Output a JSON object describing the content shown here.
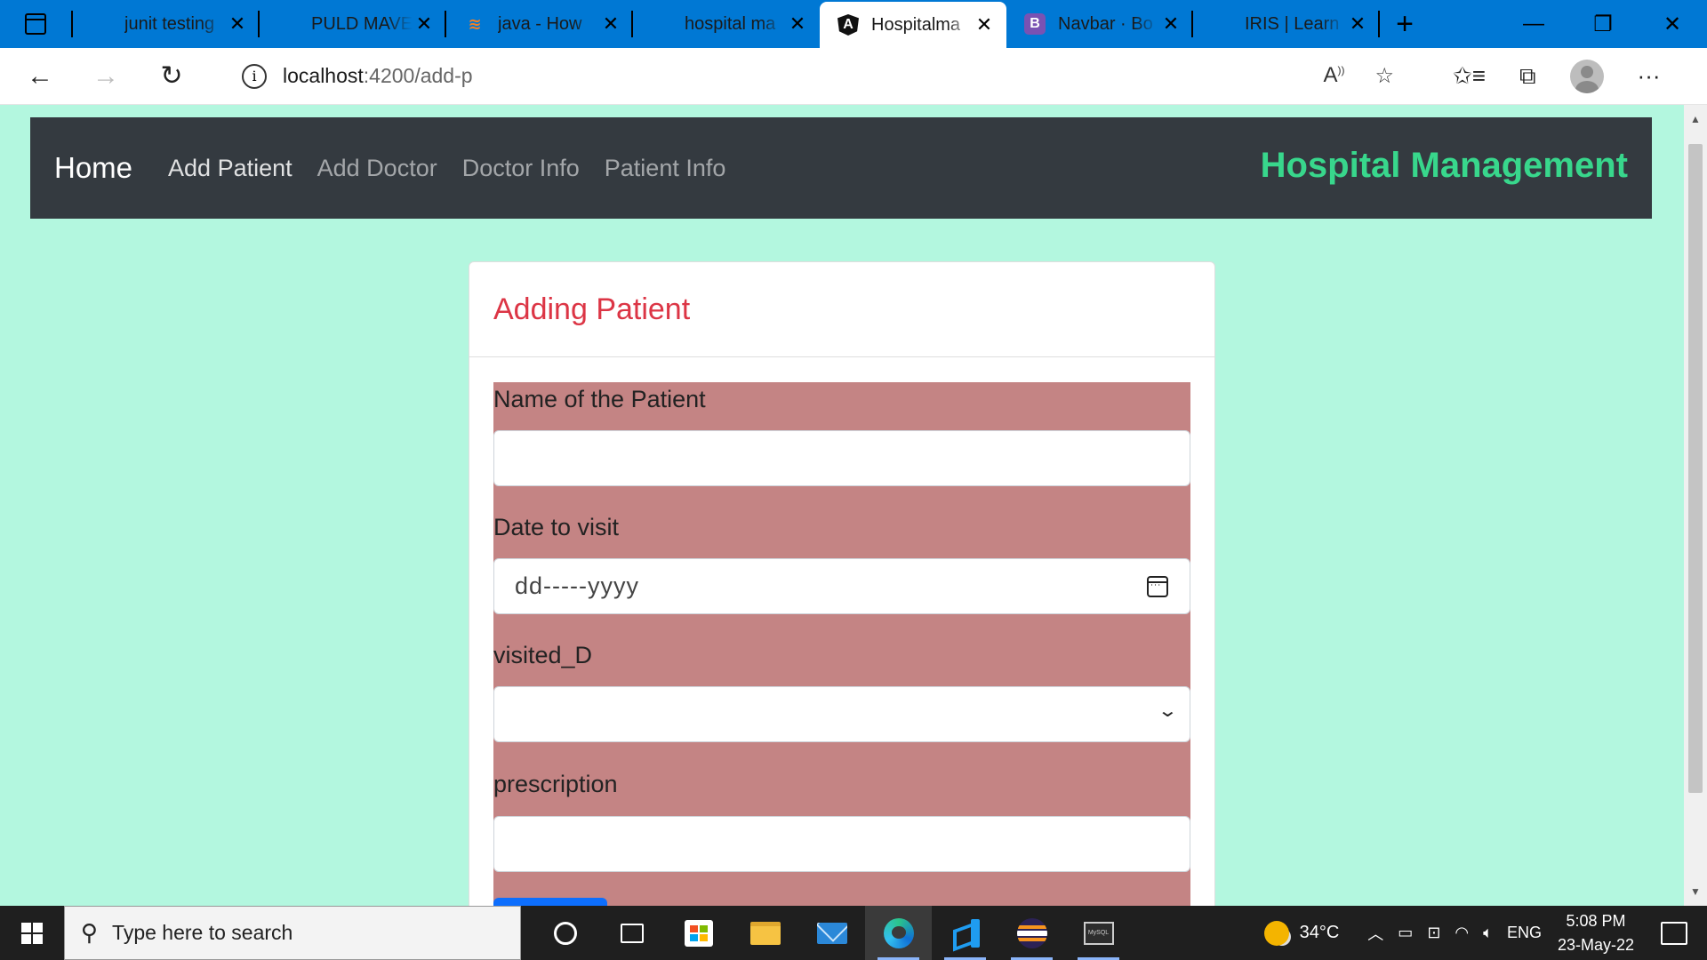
{
  "browser": {
    "tabs": [
      {
        "title": "junit testing",
        "favicon": "",
        "active": false
      },
      {
        "title": "PULD MAVEN",
        "favicon": "",
        "active": false
      },
      {
        "title": "java - How",
        "favicon": "",
        "active": false
      },
      {
        "title": "hospital ma",
        "favicon": "",
        "active": false
      },
      {
        "title": "Hospitalma",
        "favicon": "A",
        "active": true
      },
      {
        "title": "Navbar · Bo",
        "favicon": "B",
        "active": false
      },
      {
        "title": "IRIS | Learn",
        "favicon": "",
        "active": false
      }
    ],
    "address": {
      "host": "localhost",
      "path": ":4200/add-p"
    },
    "close_glyph": "✕",
    "new_tab_glyph": "+"
  },
  "app": {
    "brand": "Home",
    "nav_links": [
      "Add Patient",
      "Add Doctor",
      "Doctor Info",
      "Patient Info"
    ],
    "active_link": "Add Patient",
    "title": "Hospital Management",
    "title_color": "#38d78c",
    "navbar_color": "#343a40"
  },
  "form": {
    "heading": "Adding Patient",
    "heading_color": "#dc3545",
    "area_color": "#c48484",
    "fields": {
      "name_label": "Name of the Patient",
      "name_value": "",
      "date_label": "Date to visit",
      "date_placeholder": "dd-----yyyy",
      "visited_label": "visited_D",
      "visited_value": "",
      "prescription_label": "prescription",
      "prescription_value": ""
    }
  },
  "taskbar": {
    "search_placeholder": "Type here to search",
    "weather": "34°C",
    "language": "ENG",
    "time": "5:08 PM",
    "date": "23-May-22",
    "mysql_label": "MySQL"
  }
}
